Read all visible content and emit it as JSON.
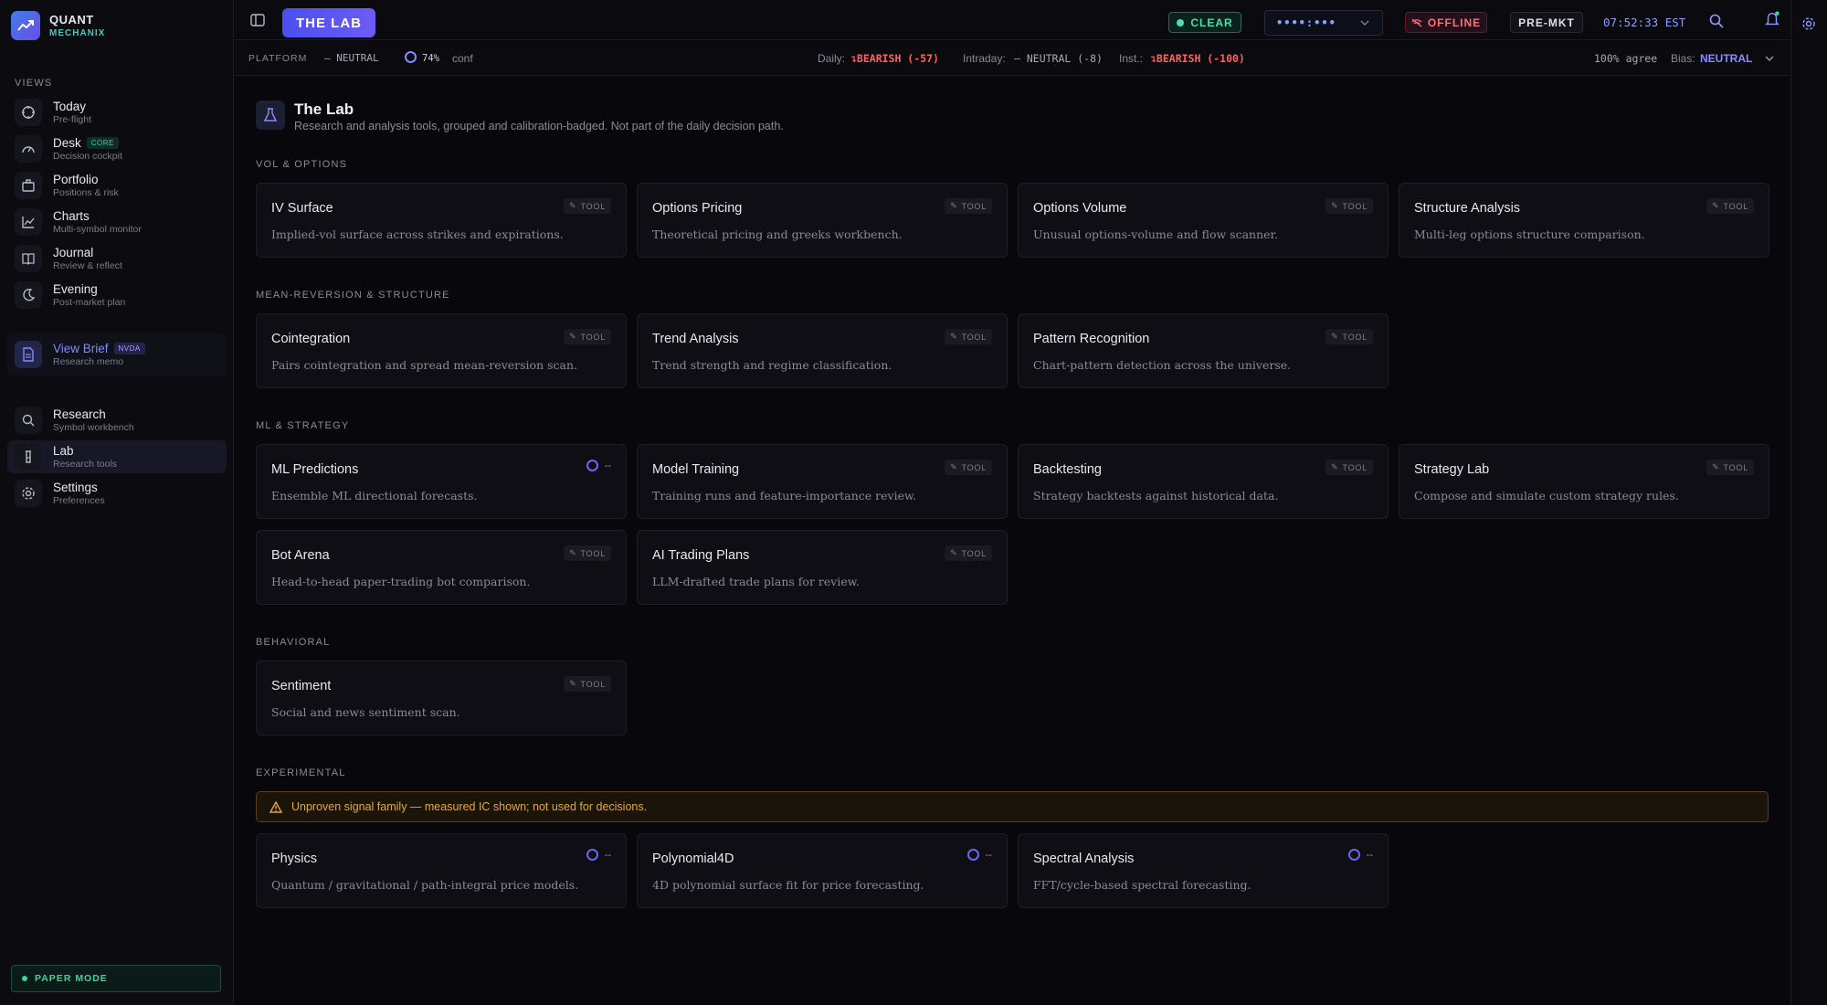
{
  "brand": {
    "line1": "QUANT",
    "line2": "MECHANIX"
  },
  "sidebar": {
    "views_label": "VIEWS",
    "items": [
      {
        "title": "Today",
        "sub": "Pre-flight",
        "icon": "crosshair-icon"
      },
      {
        "title": "Desk",
        "sub": "Decision cockpit",
        "badge": "CORE",
        "icon": "gauge-icon"
      },
      {
        "title": "Portfolio",
        "sub": "Positions & risk",
        "icon": "briefcase-icon"
      },
      {
        "title": "Charts",
        "sub": "Multi-symbol monitor",
        "icon": "line-chart-icon"
      },
      {
        "title": "Journal",
        "sub": "Review & reflect",
        "icon": "book-icon"
      },
      {
        "title": "Evening",
        "sub": "Post-market plan",
        "icon": "moon-icon"
      }
    ],
    "brief": {
      "title": "View Brief",
      "badge": "NVDA",
      "sub": "Research memo"
    },
    "tools": [
      {
        "title": "Research",
        "sub": "Symbol workbench",
        "icon": "search-icon"
      },
      {
        "title": "Lab",
        "sub": "Research tools",
        "icon": "flask-icon"
      },
      {
        "title": "Settings",
        "sub": "Preferences",
        "icon": "gear-icon"
      }
    ],
    "paper_mode": "PAPER MODE"
  },
  "topbar": {
    "lab_label": "THE LAB",
    "clear": "CLEAR",
    "selector": "••••:•••",
    "offline": "OFFLINE",
    "premkt": "PRE-MKT",
    "clock": "07:52:33 EST"
  },
  "status": {
    "platform": "PLATFORM",
    "neutral": "— NEUTRAL",
    "conf_pct": "74%",
    "conf": "conf",
    "daily_label": "Daily:",
    "daily_val": "↴BEARISH (-57)",
    "intraday_label": "Intraday:",
    "intraday_val": "— NEUTRAL (-8)",
    "inst_label": "Inst.:",
    "inst_val": "↴BEARISH (-100)",
    "agree": "100% agree",
    "bias_label": "Bias:",
    "bias_val": "NEUTRAL"
  },
  "page": {
    "title": "The Lab",
    "subtitle": "Research and analysis tools, grouped and calibration-badged. Not part of the daily decision path."
  },
  "sections": {
    "vol": "VOL & OPTIONS",
    "mr": "MEAN-REVERSION & STRUCTURE",
    "ml": "ML & STRATEGY",
    "beh": "BEHAVIORAL",
    "exp": "EXPERIMENTAL"
  },
  "tool_tag": "TOOL",
  "dash": "--",
  "cards": {
    "iv": {
      "title": "IV Surface",
      "desc": "Implied-vol surface across strikes and expirations."
    },
    "op": {
      "title": "Options Pricing",
      "desc": "Theoretical pricing and greeks workbench."
    },
    "ov": {
      "title": "Options Volume",
      "desc": "Unusual options-volume and flow scanner."
    },
    "sa": {
      "title": "Structure Analysis",
      "desc": "Multi-leg options structure comparison."
    },
    "co": {
      "title": "Cointegration",
      "desc": "Pairs cointegration and spread mean-reversion scan."
    },
    "ta": {
      "title": "Trend Analysis",
      "desc": "Trend strength and regime classification."
    },
    "pr": {
      "title": "Pattern Recognition",
      "desc": "Chart-pattern detection across the universe."
    },
    "ml": {
      "title": "ML Predictions",
      "desc": "Ensemble ML directional forecasts."
    },
    "mt": {
      "title": "Model Training",
      "desc": "Training runs and feature-importance review."
    },
    "bt": {
      "title": "Backtesting",
      "desc": "Strategy backtests against historical data."
    },
    "sl": {
      "title": "Strategy Lab",
      "desc": "Compose and simulate custom strategy rules."
    },
    "ba": {
      "title": "Bot Arena",
      "desc": "Head-to-head paper-trading bot comparison."
    },
    "ai": {
      "title": "AI Trading Plans",
      "desc": "LLM-drafted trade plans for review."
    },
    "se": {
      "title": "Sentiment",
      "desc": "Social and news sentiment scan."
    },
    "ph": {
      "title": "Physics",
      "desc": "Quantum / gravitational / path-integral price models."
    },
    "po": {
      "title": "Polynomial4D",
      "desc": "4D polynomial surface fit for price forecasting."
    },
    "sp": {
      "title": "Spectral Analysis",
      "desc": "FFT/cycle-based spectral forecasting."
    }
  },
  "warning": "Unproven signal family — measured IC shown; not used for decisions."
}
